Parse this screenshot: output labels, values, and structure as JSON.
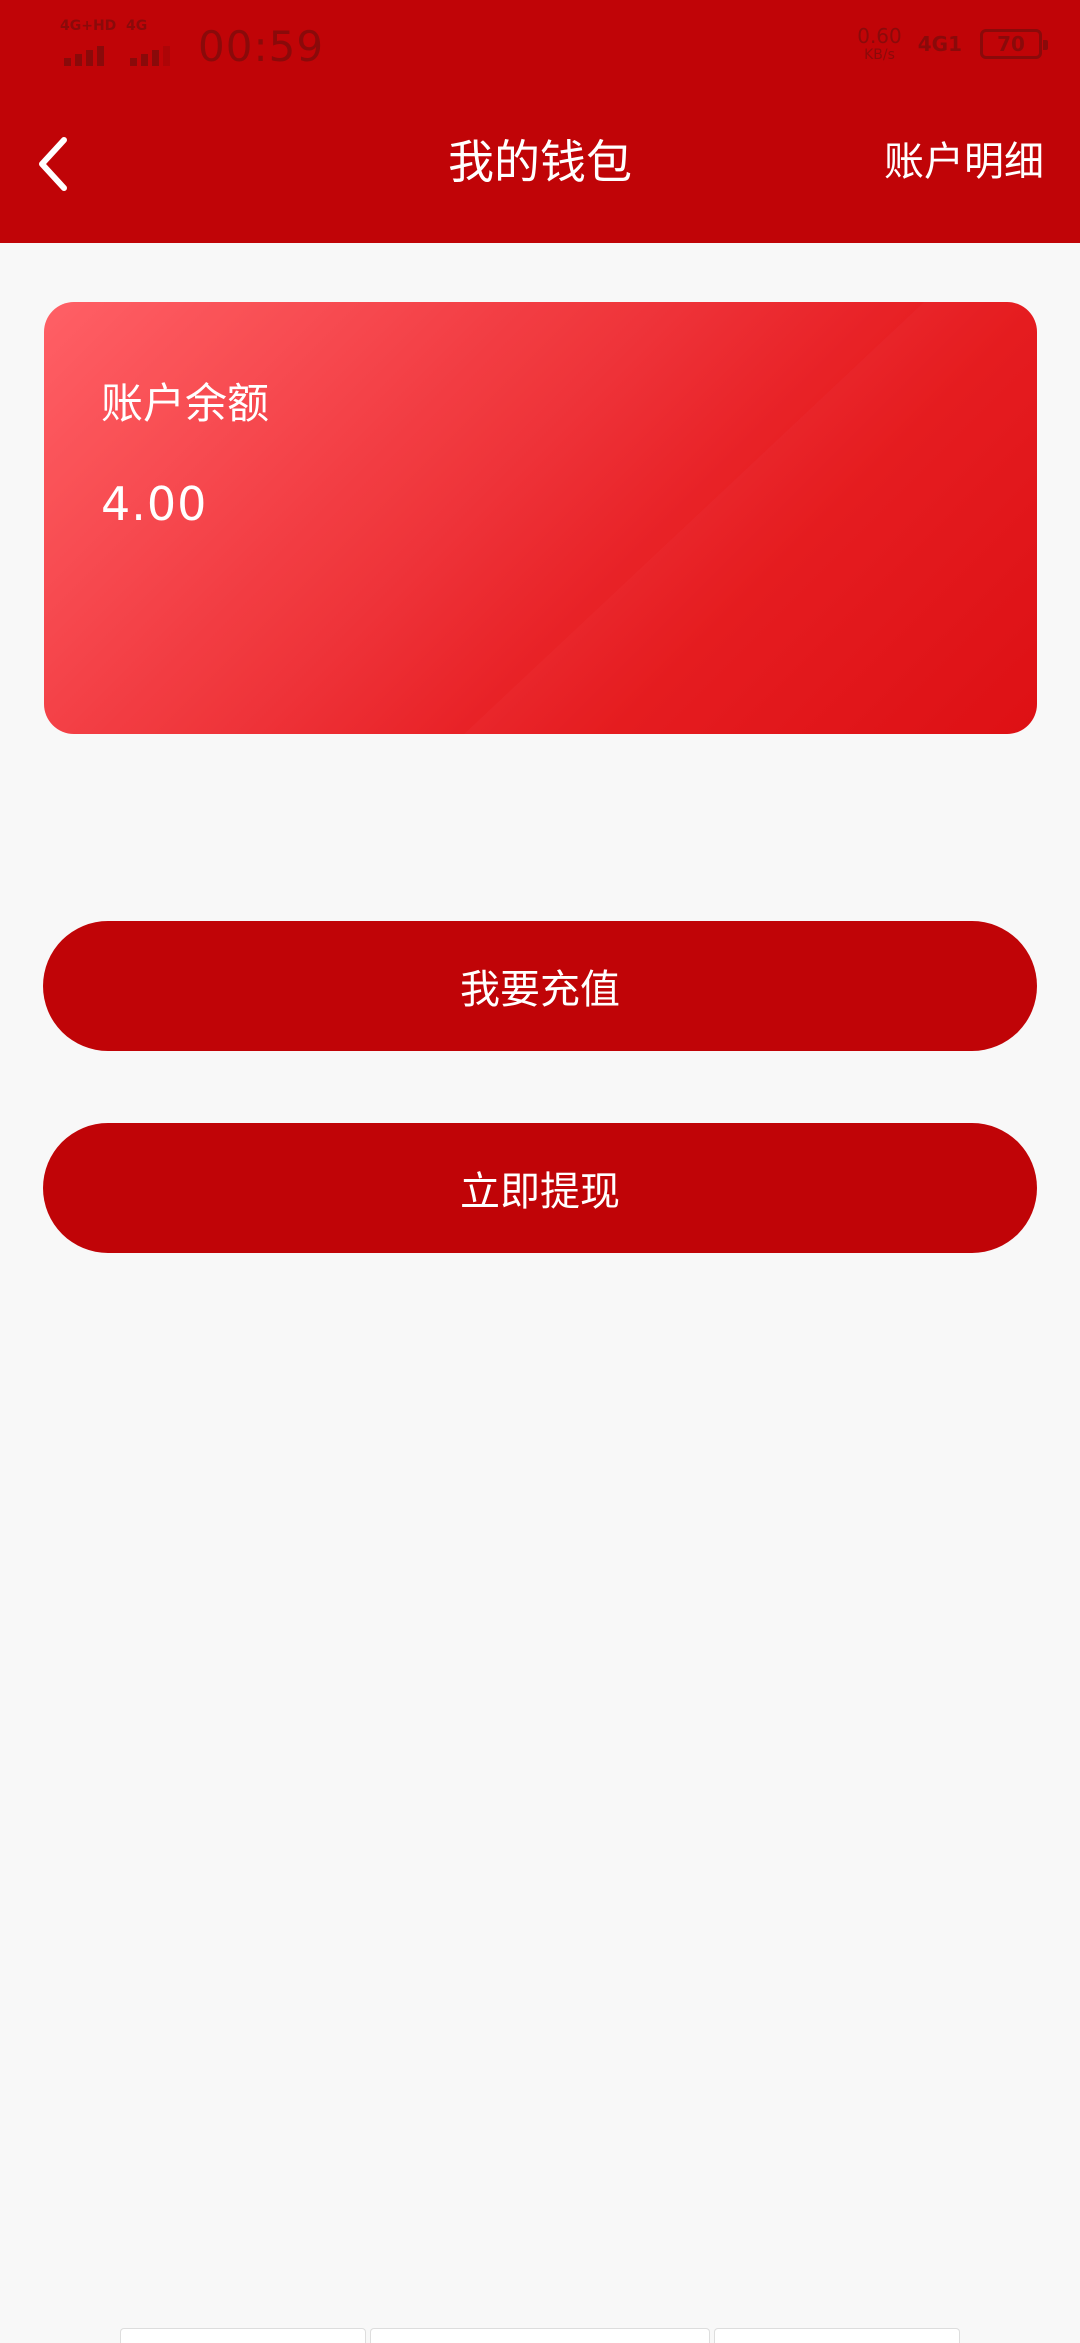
{
  "status_bar": {
    "sim1_label": "4G+HD",
    "sim2_label": "4G",
    "time": "00:59",
    "net_speed_value": "0.60",
    "net_speed_unit": "KB/s",
    "network_type": "4G1",
    "battery_level": "70"
  },
  "header": {
    "title": "我的钱包",
    "detail_link": "账户明细",
    "background_color": "#c00407"
  },
  "balance_card": {
    "label": "账户余额",
    "amount": "4.00"
  },
  "actions": {
    "recharge_label": "我要充值",
    "withdraw_label": "立即提现",
    "button_color": "#c00407"
  }
}
